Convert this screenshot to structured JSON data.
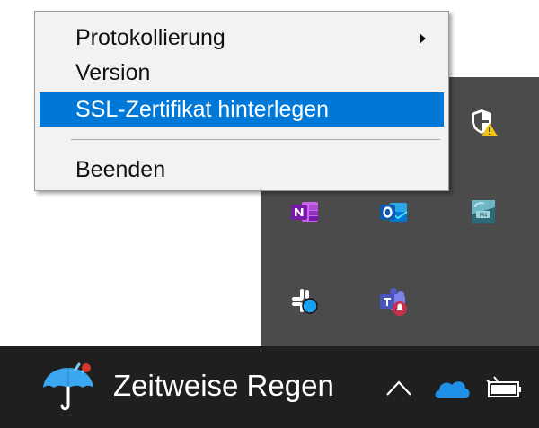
{
  "context_menu": {
    "items": [
      {
        "label": "Protokollierung",
        "has_submenu": true
      },
      {
        "label": "Version"
      },
      {
        "label": "SSL-Zertifikat hinterlegen",
        "selected": true
      },
      {
        "label": "Beenden"
      }
    ]
  },
  "tray_flyout": {
    "icons": [
      "security-warning-icon",
      "onenote-icon",
      "outlook-icon",
      "app-icon",
      "slack-icon",
      "teams-icon"
    ]
  },
  "taskbar": {
    "weather_text": "Zeitweise Regen",
    "icons": [
      "weather-rain-icon",
      "chevron-up-icon",
      "onedrive-icon",
      "battery-icon"
    ]
  },
  "colors": {
    "selection": "#0078d7",
    "taskbar": "#1f1f1f",
    "flyout": "#4b4b4b",
    "menu_bg": "#f2f2f2"
  }
}
